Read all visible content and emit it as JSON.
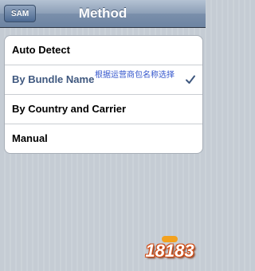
{
  "navbar": {
    "back_label": "SAM",
    "title": "Method"
  },
  "options": [
    {
      "label": "Auto Detect",
      "selected": false
    },
    {
      "label": "By Bundle Name",
      "selected": true,
      "annotation": "根据运营商包名称选择"
    },
    {
      "label": "By Country and Carrier",
      "selected": false
    },
    {
      "label": "Manual",
      "selected": false
    }
  ],
  "watermark": {
    "text": "18183"
  },
  "colors": {
    "selected_text": "#3f587f",
    "annotation": "#3355cc",
    "navbar": "#7a8fab"
  }
}
